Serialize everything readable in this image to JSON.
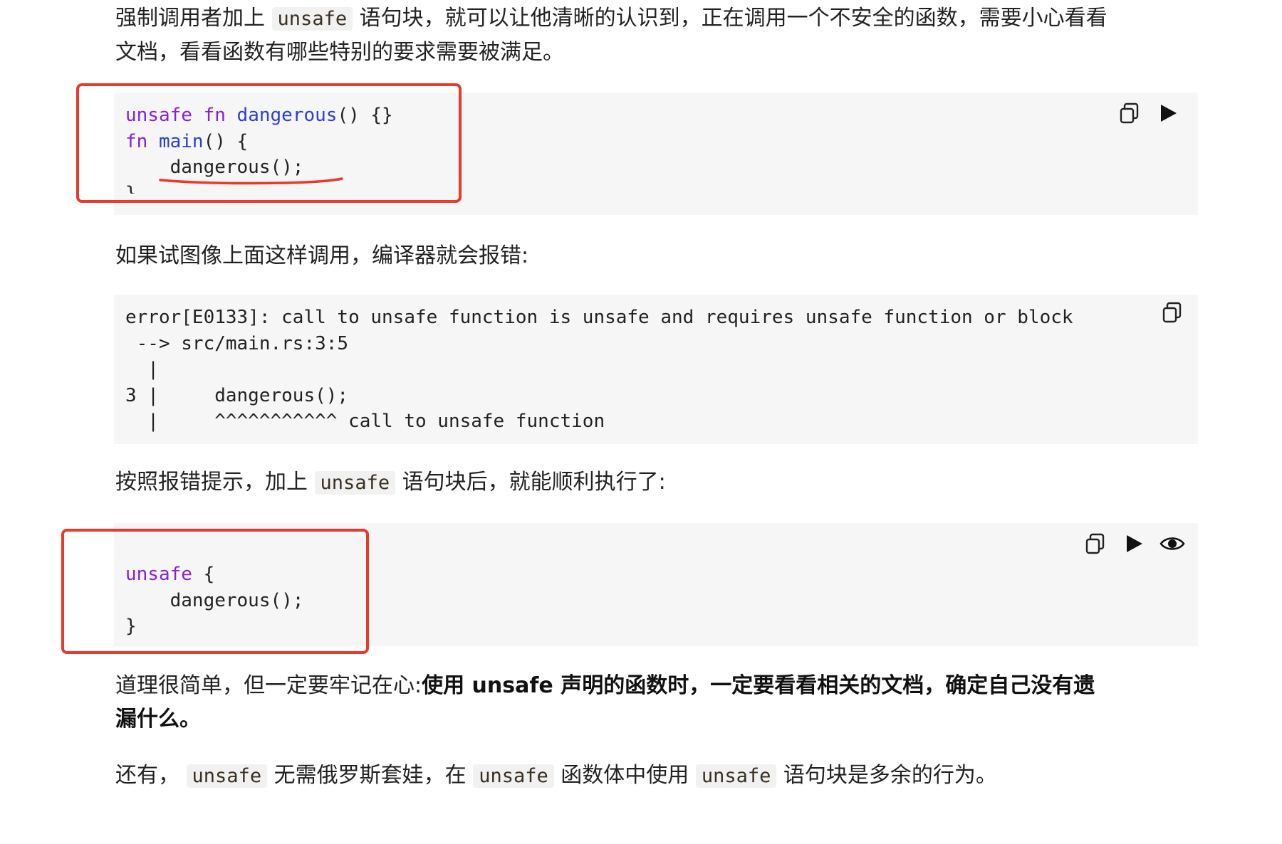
{
  "paragraphs": {
    "p1_a": "强制调用者加上",
    "p1_code": "unsafe",
    "p1_b": "语句块，就可以让他清晰的认识到，正在调用一个不安全的函数，需要小心看看",
    "p1_c": "文档，看看函数有哪些特别的要求需要被满足。",
    "p2": "如果试图像上面这样调用，编译器就会报错:",
    "p3_a": "按照报错提示，加上",
    "p3_code": "unsafe",
    "p3_b": "语句块后，就能顺利执行了:",
    "p4_a": "道理很简单，但一定要牢记在心:",
    "p4_bold_a": "使用 unsafe 声明的函数时，一定要看看相关的文档，确定自己没有遗",
    "p4_bold_b": "漏什么。",
    "p5_a": "还有，",
    "p5_code1": "unsafe",
    "p5_b": "无需俄罗斯套娃，在",
    "p5_code2": "unsafe",
    "p5_c": "函数体中使用",
    "p5_code3": "unsafe",
    "p5_d": "语句块是多余的行为。"
  },
  "code1": {
    "kw_unsafe": "unsafe",
    "kw_fn": "fn",
    "fn_dangerous": "dangerous",
    "sig_rest": "() {}",
    "kw_fn2": "fn",
    "fn_main": "main",
    "main_rest": "() {",
    "call": "    dangerous();",
    "close": "}"
  },
  "code2": {
    "line1": "error[E0133]: call to unsafe function is unsafe and requires unsafe function or block",
    "line2": " --> src/main.rs:3:5",
    "line3": "  |",
    "line4": "3 |     dangerous();",
    "line5": "  |     ^^^^^^^^^^^ call to unsafe function"
  },
  "code3": {
    "kw_unsafe": "unsafe",
    "open_rest": " {",
    "call": "    dangerous();",
    "close": "}"
  },
  "colors": {
    "keyword": "#8a1fd6",
    "function_name": "#2b3fd1",
    "annotation_red": "#e8392b",
    "code_background": "#f6f6f6"
  },
  "icons": [
    "copy-icon",
    "play-icon",
    "eye-icon"
  ]
}
